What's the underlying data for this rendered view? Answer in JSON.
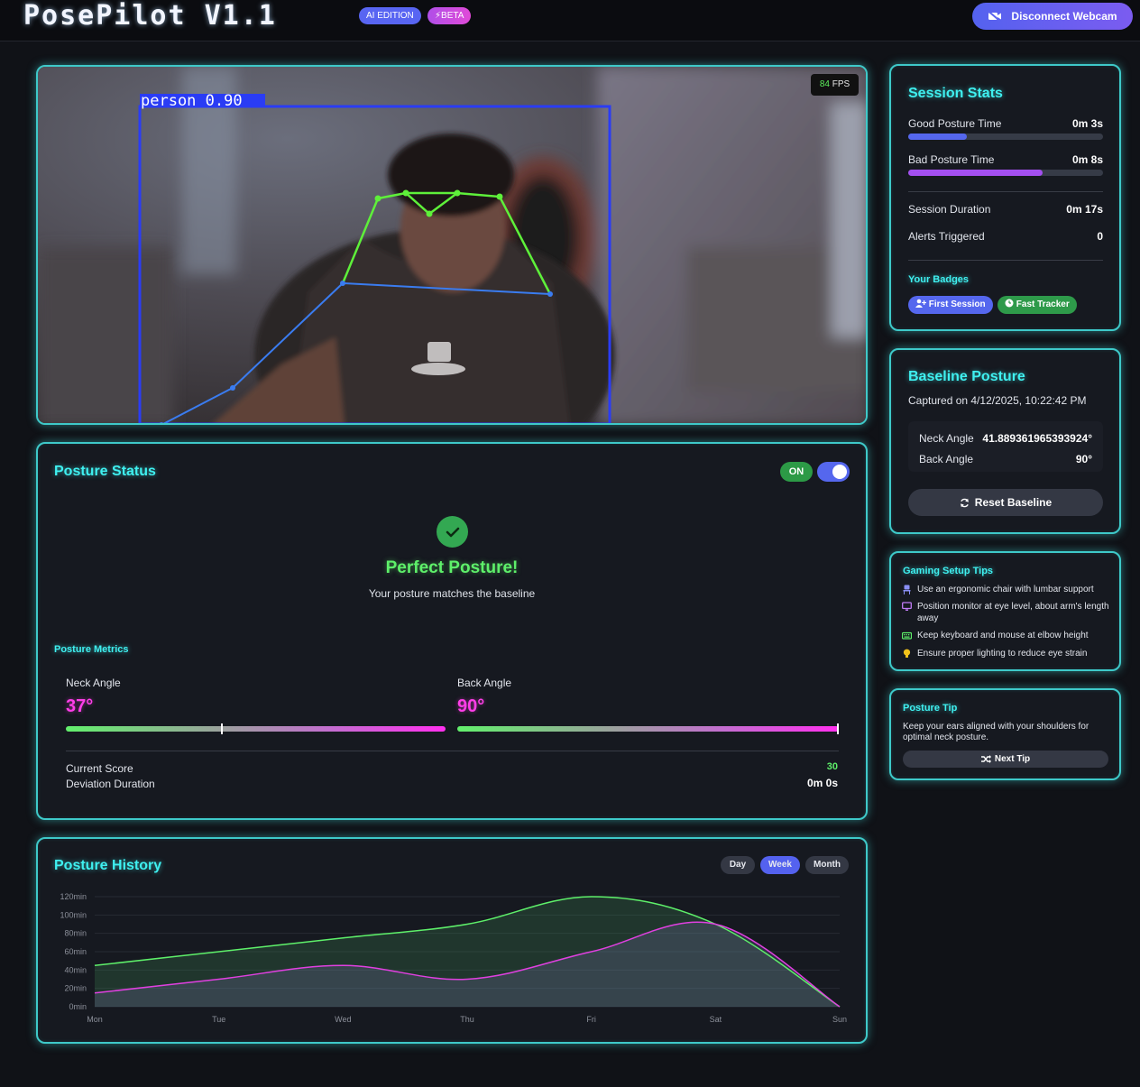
{
  "header": {
    "logo": "PosePilot V1.1",
    "ai_badge": "AI EDITION",
    "beta_badge": "BETA",
    "disconnect_label": "Disconnect Webcam"
  },
  "webcam": {
    "fps_value": "84",
    "fps_unit": "FPS",
    "detection_label": "person 0.90"
  },
  "posture_status": {
    "title": "Posture Status",
    "toggle_label": "ON",
    "headline": "Perfect Posture!",
    "subtext": "Your posture matches the baseline",
    "metrics_title": "Posture Metrics",
    "neck_label": "Neck Angle",
    "neck_value": "37°",
    "neck_fraction": 0.41,
    "back_label": "Back Angle",
    "back_value": "90°",
    "back_fraction": 1.0,
    "score_label": "Current Score",
    "score_value": "30",
    "deviation_label": "Deviation Duration",
    "deviation_value": "0m 0s"
  },
  "history": {
    "title": "Posture History",
    "ranges": [
      "Day",
      "Week",
      "Month"
    ],
    "active_range": "Week"
  },
  "chart_data": {
    "type": "area",
    "categories": [
      "Mon",
      "Tue",
      "Wed",
      "Thu",
      "Fri",
      "Sat",
      "Sun"
    ],
    "y_ticks": [
      "0min",
      "20min",
      "40min",
      "60min",
      "80min",
      "100min",
      "120min"
    ],
    "ylim": [
      0,
      120
    ],
    "grid": true,
    "series": [
      {
        "color": "#5ef06a",
        "values": [
          45,
          60,
          75,
          90,
          120,
          90,
          0
        ]
      },
      {
        "color": "#e040e0",
        "values": [
          15,
          30,
          45,
          30,
          60,
          90,
          0
        ]
      }
    ]
  },
  "session_stats": {
    "title": "Session Stats",
    "good_label": "Good Posture Time",
    "good_value": "0m 3s",
    "good_fraction": 0.3,
    "bad_label": "Bad Posture Time",
    "bad_value": "0m 8s",
    "bad_fraction": 0.69,
    "duration_label": "Session Duration",
    "duration_value": "0m 17s",
    "alerts_label": "Alerts Triggered",
    "alerts_value": "0",
    "badges_title": "Your Badges",
    "badges": [
      "First Session",
      "Fast Tracker"
    ],
    "colors": {
      "good": "#5567ee",
      "bad": "#a34ff0",
      "badge1": "#5567ee",
      "badge2": "#2e9a4a"
    }
  },
  "baseline": {
    "title": "Baseline Posture",
    "captured": "Captured on 4/12/2025, 10:22:42 PM",
    "neck_label": "Neck Angle",
    "neck_value": "41.889361965393924°",
    "back_label": "Back Angle",
    "back_value": "90°",
    "reset_label": "Reset Baseline"
  },
  "tips": {
    "title": "Gaming Setup Tips",
    "items": [
      {
        "icon": "chair-icon",
        "text": "Use an ergonomic chair with lumbar support"
      },
      {
        "icon": "monitor-icon",
        "text": "Position monitor at eye level, about arm's length away"
      },
      {
        "icon": "keyboard-icon",
        "text": "Keep keyboard and mouse at elbow height"
      },
      {
        "icon": "lightbulb-icon",
        "text": "Ensure proper lighting to reduce eye strain"
      }
    ]
  },
  "posture_tip": {
    "title": "Posture Tip",
    "text": "Keep your ears aligned with your shoulders for optimal neck posture.",
    "next_label": "Next Tip"
  }
}
